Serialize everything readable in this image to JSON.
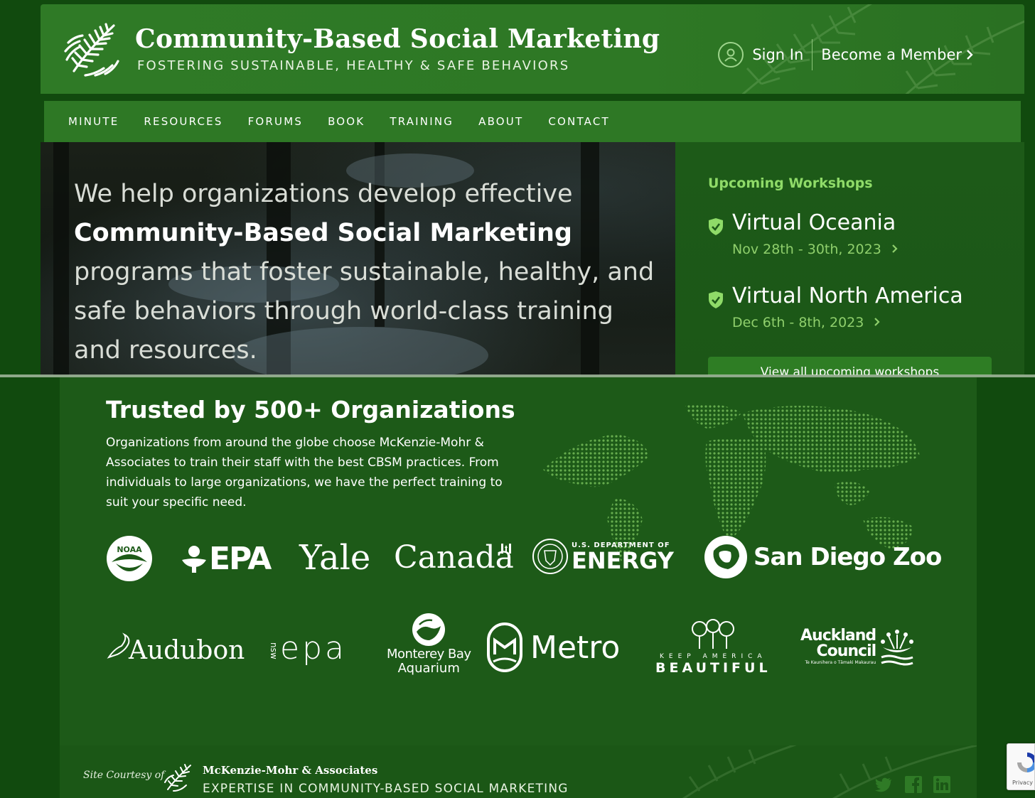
{
  "header": {
    "title": "Community-Based Social Marketing",
    "tagline": "FOSTERING SUSTAINABLE, HEALTHY & SAFE BEHAVIORS",
    "sign_in": "Sign In",
    "become_member": "Become a Member"
  },
  "nav": {
    "items": [
      "MINUTE",
      "RESOURCES",
      "FORUMS",
      "BOOK",
      "TRAINING",
      "ABOUT",
      "CONTACT"
    ]
  },
  "hero": {
    "line_intro": "We help organizations develop effective",
    "line_bold": "Community-Based Social Marketing",
    "line_rest": "programs that foster sustainable, healthy, and safe behaviors through world-class training and resources."
  },
  "workshops": {
    "heading": "Upcoming Workshops",
    "items": [
      {
        "title": "Virtual Oceania",
        "date": "Nov 28th - 30th, 2023"
      },
      {
        "title": "Virtual North America",
        "date": "Dec 6th - 8th, 2023"
      }
    ],
    "view_all": "View all upcoming workshops"
  },
  "trusted": {
    "title": "Trusted by 500+ Organizations",
    "body": "Organizations from around the globe choose McKenzie-Mohr & Associates to train their staff with the best CBSM practices. From individuals to large organizations, we have the perfect training to suit your specific need.",
    "logos": {
      "noaa": "NOAA",
      "epa": "EPA",
      "yale": "Yale",
      "canada": "Canada",
      "doe_small": "U.S. DEPARTMENT OF",
      "doe_big": "ENERGY",
      "sdzoo": "San Diego Zoo",
      "audubon": "Audubon",
      "nsw": "nsw",
      "nsw_epa": "epa",
      "monterey_1": "Monterey Bay",
      "monterey_2": "Aquarium",
      "metro": "Metro",
      "kab_small": "KEEP AMERICA",
      "kab_big": "BEAUTIFUL",
      "auckland_1": "Auckland",
      "auckland_2": "Council",
      "auckland_sub": "Te Kaunihera o Tāmaki Makaurau"
    }
  },
  "footer": {
    "courtesy": "Site Courtesy of",
    "company": "McKenzie-Mohr & Associates",
    "tagline": "EXPERTISE IN COMMUNITY-BASED SOCIAL MARKETING"
  },
  "recaptcha": {
    "text": "Privacy - Terms"
  },
  "colors": {
    "header_green": "#2f7a26",
    "panel_green": "#1d5a18",
    "accent_lime": "#8fdb68",
    "date_green": "#8fcf6c"
  }
}
